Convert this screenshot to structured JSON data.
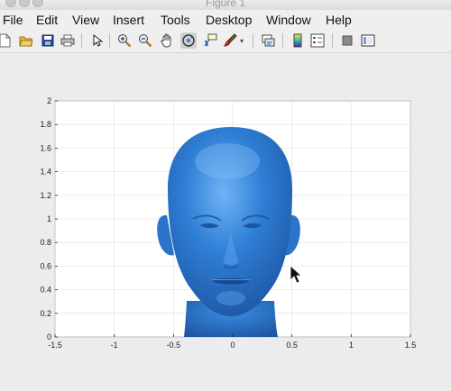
{
  "window": {
    "title": "Figure 1"
  },
  "menu": {
    "items": [
      "File",
      "Edit",
      "View",
      "Insert",
      "Tools",
      "Desktop",
      "Window",
      "Help"
    ]
  },
  "toolbar": {
    "buttons": [
      "new-figure-icon",
      "open-file-icon",
      "save-icon",
      "print-icon",
      "select-arrow-icon",
      "zoom-in-icon",
      "zoom-out-icon",
      "pan-hand-icon",
      "rotate-3d-icon",
      "data-cursor-icon",
      "brush-icon",
      "link-plot-icon",
      "colorbar-icon",
      "legend-icon",
      "hide-plot-tools-icon",
      "show-plot-tools-icon"
    ],
    "active": "rotate-3d-icon"
  },
  "colors": {
    "surface": "#2f7fd6",
    "axes_bg": "#ffffff",
    "grid": "#e6e6e6"
  },
  "axes": {
    "x_ticks": [
      "-1.5",
      "-1",
      "-0.5",
      "0",
      "0.5",
      "1",
      "1.5"
    ],
    "y_ticks": [
      "0",
      "0.2",
      "0.4",
      "0.6",
      "0.8",
      "1",
      "1.2",
      "1.4",
      "1.6",
      "1.8",
      "2"
    ],
    "xlim": [
      -1.5,
      1.5
    ],
    "ylim": [
      0,
      2
    ],
    "grid": true,
    "content": "3-D surface render of a human head (blue, lit)"
  }
}
